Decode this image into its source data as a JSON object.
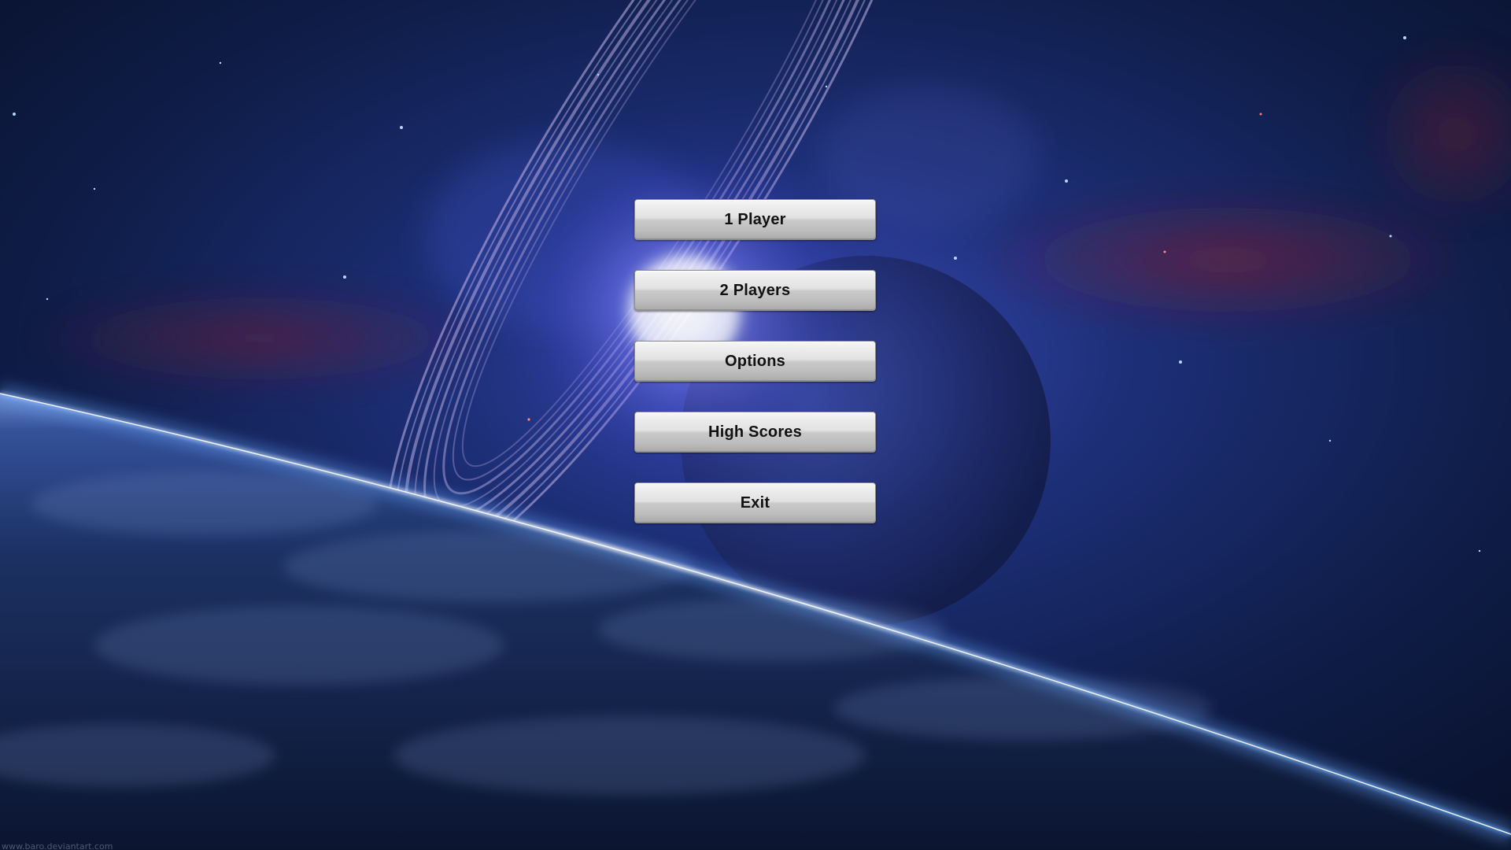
{
  "menu": {
    "buttons": [
      {
        "label": "1 Player"
      },
      {
        "label": "2 Players"
      },
      {
        "label": "Options"
      },
      {
        "label": "High Scores"
      },
      {
        "label": "Exit"
      }
    ]
  },
  "background": {
    "credit": "www.baro.deviantart.com",
    "space_color": "#0b1630",
    "glow_color": "#6b6cff",
    "planet_rim_color": "#cfe6ff",
    "nebula_red": "#8a1f2c"
  }
}
